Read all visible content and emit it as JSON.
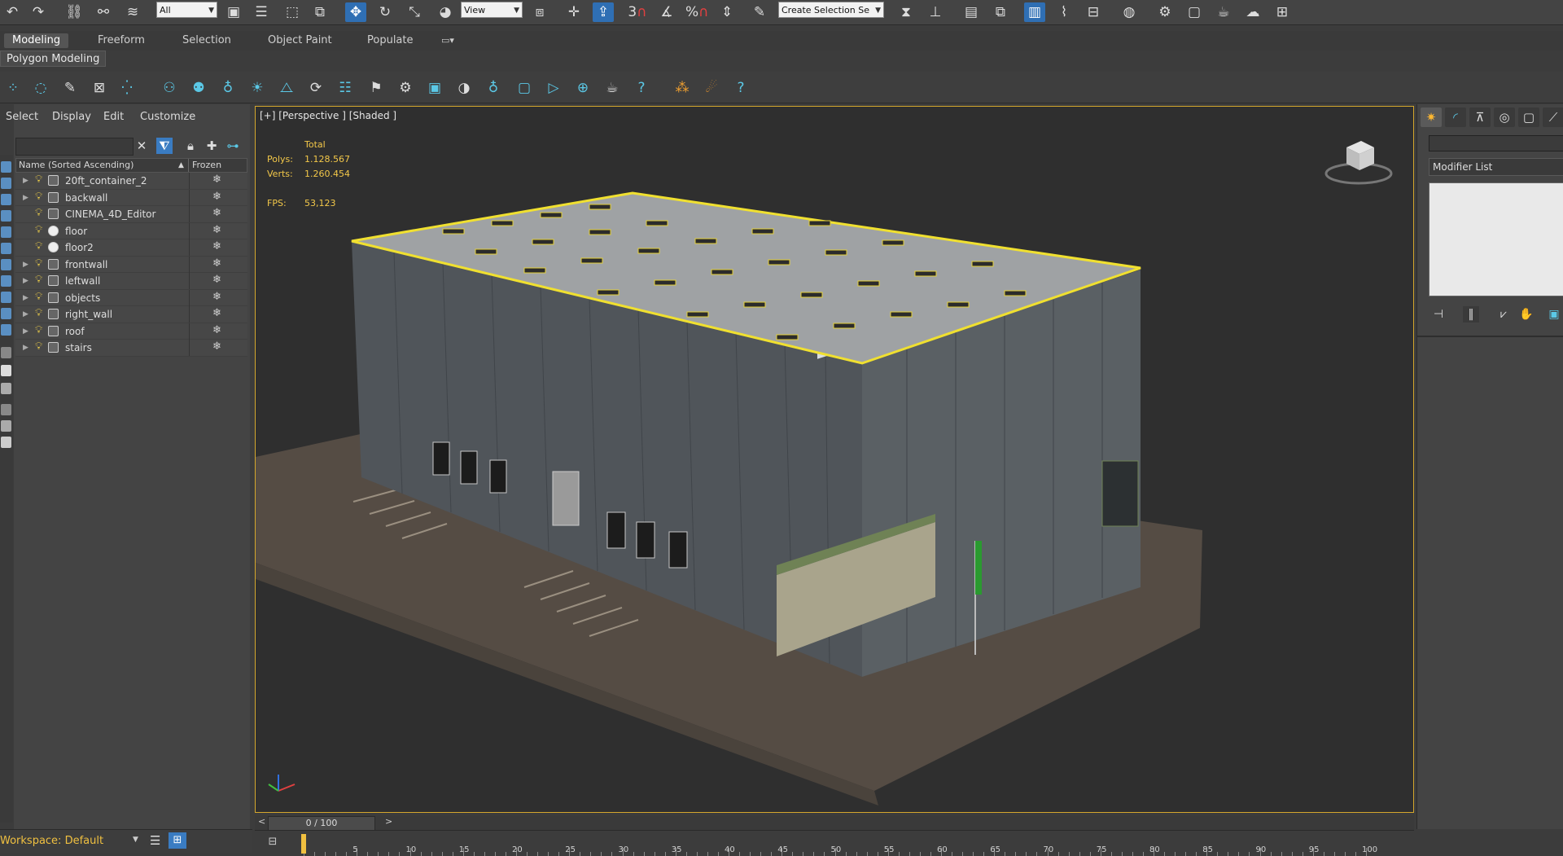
{
  "toolbar": {
    "selection_filter": "All",
    "ref_coord": "View",
    "selection_set_placeholder": "Create Selection Se",
    "snap_angle_label": "3",
    "percent_label": "%",
    "undo_icon": "undo-icon",
    "redo_icon": "redo-icon"
  },
  "ribbon": {
    "tabs": [
      "Modeling",
      "Freeform",
      "Selection",
      "Object Paint",
      "Populate"
    ],
    "active_tab": "Modeling",
    "subpanel": "Polygon Modeling"
  },
  "scene_explorer": {
    "menu": [
      "Select",
      "Display",
      "Edit",
      "Customize"
    ],
    "column_name": "Name (Sorted Ascending)",
    "column_frozen": "Frozen",
    "rows": [
      {
        "name": "20ft_container_2",
        "expandable": true,
        "icon": "box"
      },
      {
        "name": "backwall",
        "expandable": true,
        "icon": "box"
      },
      {
        "name": "CINEMA_4D_Editor",
        "expandable": false,
        "icon": "camera"
      },
      {
        "name": "floor",
        "expandable": false,
        "icon": "sphere"
      },
      {
        "name": "floor2",
        "expandable": false,
        "icon": "sphere"
      },
      {
        "name": "frontwall",
        "expandable": true,
        "icon": "box"
      },
      {
        "name": "leftwall",
        "expandable": true,
        "icon": "box"
      },
      {
        "name": "objects",
        "expandable": true,
        "icon": "box"
      },
      {
        "name": "right_wall",
        "expandable": true,
        "icon": "box"
      },
      {
        "name": "roof",
        "expandable": true,
        "icon": "box"
      },
      {
        "name": "stairs",
        "expandable": true,
        "icon": "box"
      }
    ]
  },
  "workspace": {
    "label": "Workspace: Default"
  },
  "viewport": {
    "label": "[+] [Perspective ] [Shaded ]",
    "stats": {
      "total_label": "Total",
      "polys_label": "Polys:",
      "polys_value": "1.128.567",
      "verts_label": "Verts:",
      "verts_value": "1.260.454",
      "fps_label": "FPS:",
      "fps_value": "53,123"
    },
    "colors": {
      "border": "#d4a72c",
      "selection_outline": "#f0e030",
      "stats_text": "#f3c849"
    }
  },
  "command_panel": {
    "modifier_list": "Modifier List"
  },
  "timeline": {
    "slider": "0 / 100",
    "frame_current": 0,
    "frame_end": 100,
    "labels": [
      "5",
      "10",
      "15",
      "20",
      "25",
      "30",
      "35",
      "40",
      "45",
      "50",
      "55",
      "60",
      "65",
      "70",
      "75",
      "80",
      "85",
      "90",
      "95",
      "100"
    ]
  }
}
